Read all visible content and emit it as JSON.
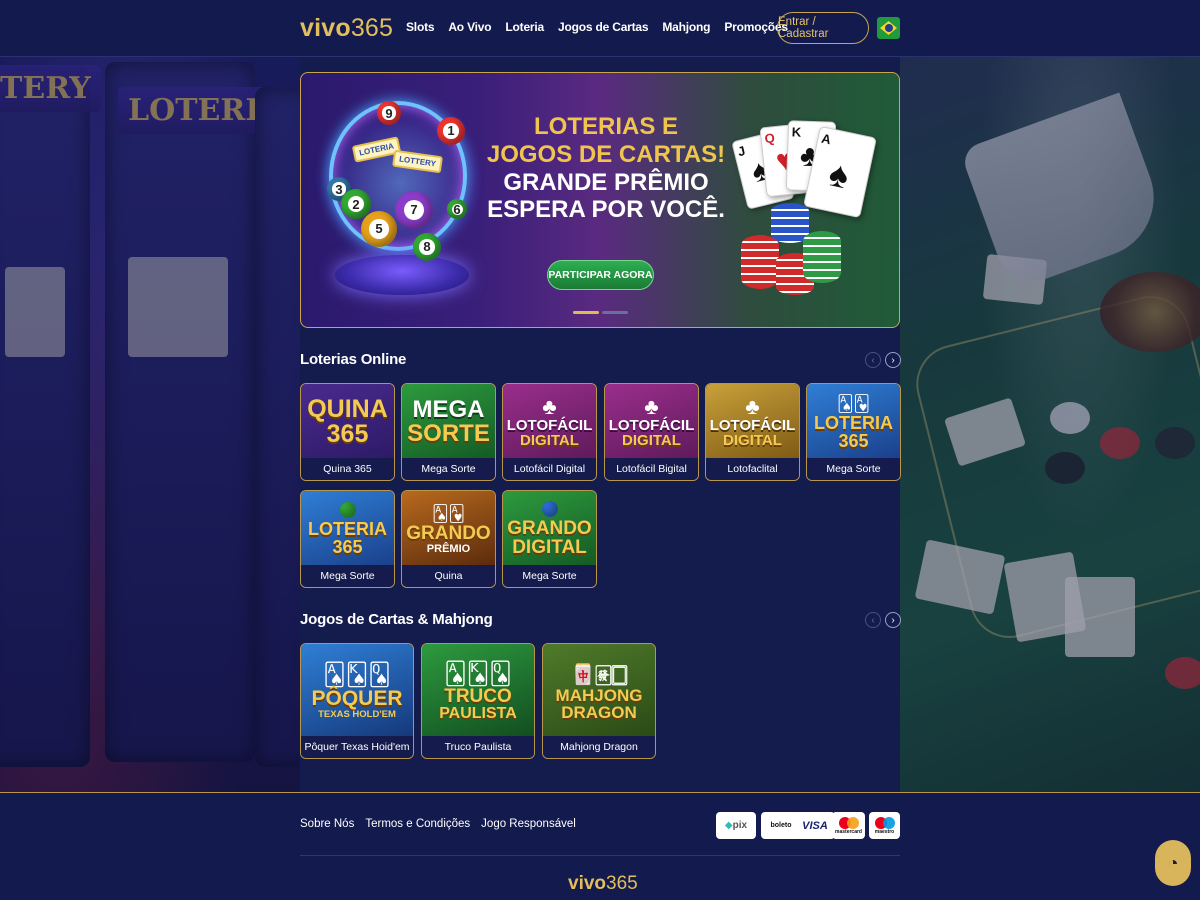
{
  "header": {
    "logo_text": "vivo",
    "logo_num": "365",
    "nav": [
      "Slots",
      "Ao Vivo",
      "Loteria",
      "Jogos de Cartas",
      "Mahjong",
      "Promoções"
    ],
    "login_label": "Entrar / Cadastrar",
    "language_flag": "brazil-flag-icon"
  },
  "banner": {
    "line1": "LOTERIAS E",
    "line2": "JOGOS DE CARTAS!",
    "line3": "GRANDE PRÊMIO",
    "line4": "ESPERA POR VOCÊ.",
    "cta": "PARTICIPAR AGORA",
    "ticket1": "LOTERIA",
    "ticket2": "LOTTERY",
    "slides": 2,
    "active_slide": 1
  },
  "lotteries": {
    "title": "Loterias Online",
    "items": [
      {
        "art_title": "QUINA",
        "art_sub": "365",
        "caption": "Quina 365"
      },
      {
        "art_title": "MEGA",
        "art_sub": "SORTE",
        "caption": "Mega Sorte"
      },
      {
        "art_title": "LOTOFÁCIL",
        "art_sub": "DIGITAL",
        "caption": "Lotofácil Digital"
      },
      {
        "art_title": "LOTOFÁCIL",
        "art_sub": "DIGITAL",
        "caption": "Lotofácil Bigital"
      },
      {
        "art_title": "LOTOFÁCIL",
        "art_sub": "DIGITAL",
        "caption": "Lotofaclital"
      },
      {
        "art_title": "LOTERIA",
        "art_sub": "365",
        "caption": "Mega Sorte"
      },
      {
        "art_title": "LOTERIA",
        "art_sub": "365",
        "caption": "Mega Sorte"
      },
      {
        "art_title": "GRANDO",
        "art_sub": "PRÊMIO",
        "caption": "Quina"
      },
      {
        "art_title": "GRANDO",
        "art_sub": "DIGITAL",
        "caption": "Mega Sorte"
      }
    ]
  },
  "cards": {
    "title": "Jogos de Cartas & Mahjong",
    "items": [
      {
        "art_title": "PÔQUER",
        "art_sub": "TEXAS HOLD'EM",
        "caption": "Pôquer Texas Hoid'em"
      },
      {
        "art_title": "TRUCO",
        "art_sub": "PAULISTA",
        "caption": "Truco Paulista"
      },
      {
        "art_title": "MAHJONG",
        "art_sub": "DRAGON",
        "caption": "Mahjong Dragon"
      }
    ]
  },
  "footer": {
    "links": [
      "Sobre Nós",
      "Termos e Condições",
      "Jogo Responsável"
    ],
    "payments": [
      {
        "label": "pix",
        "icon": "pix-icon"
      },
      {
        "label": "boleto",
        "icon": "barcode-icon"
      },
      {
        "label": "VISA",
        "icon": "visa-icon"
      },
      {
        "label": "mastercard",
        "icon": "mastercard-icon"
      },
      {
        "label": "maestro",
        "icon": "maestro-icon"
      }
    ],
    "logo_text": "vivo",
    "logo_num": "365"
  },
  "chat": {
    "icon": "chat-icon"
  },
  "colors": {
    "gold": "#e2be5c",
    "navy": "#141b4d",
    "green": "#1f9a3c"
  }
}
